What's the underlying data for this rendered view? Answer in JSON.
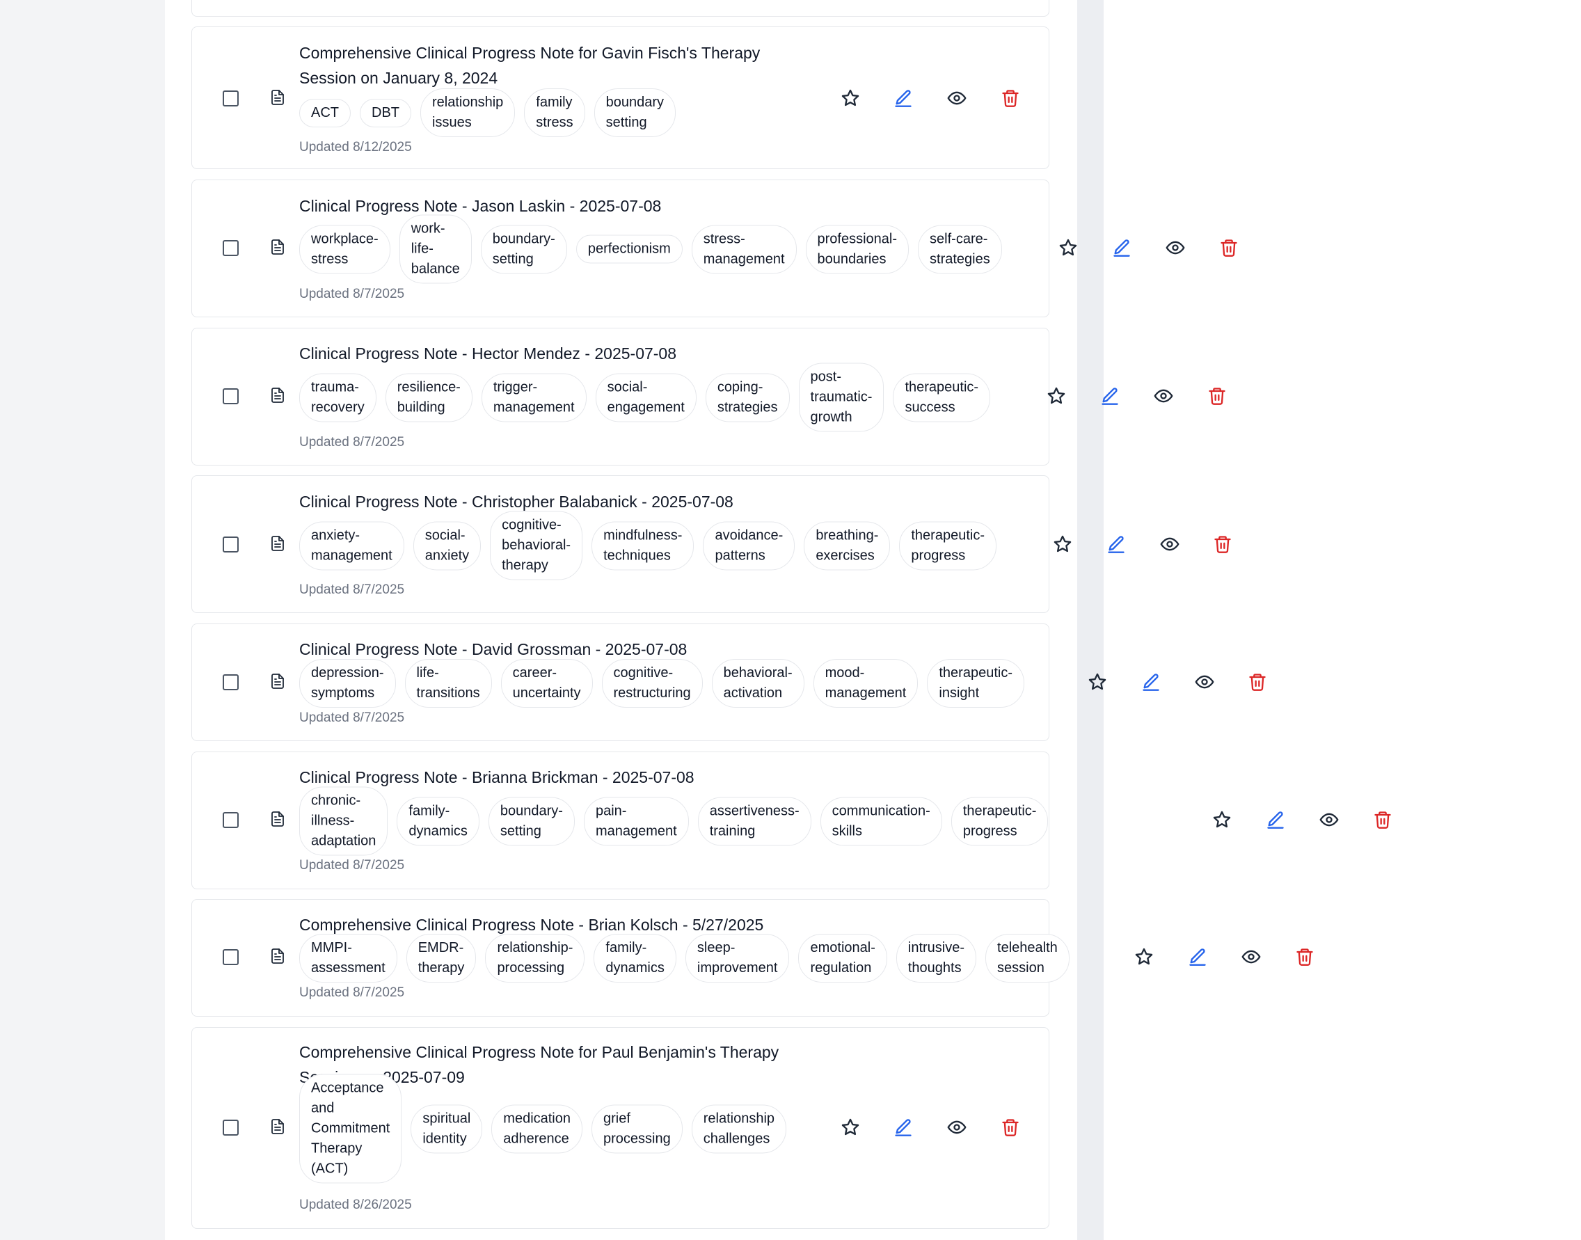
{
  "notes": [
    {
      "title": "Comprehensive Clinical Progress Note for Gavin Fisch's Therapy\nSession on January 8, 2024",
      "tags": [
        "ACT",
        "DBT",
        "relationship\nissues",
        "family\nstress",
        "boundary\nsetting"
      ],
      "updated": "Updated 8/12/2025"
    },
    {
      "title": "Clinical Progress Note - Jason Laskin - 2025-07-08",
      "tags": [
        "workplace-\nstress",
        "work-\nlife-\nbalance",
        "boundary-\nsetting",
        "perfectionism",
        "stress-\nmanagement",
        "professional-\nboundaries",
        "self-care-\nstrategies"
      ],
      "updated": "Updated 8/7/2025"
    },
    {
      "title": "Clinical Progress Note - Hector Mendez - 2025-07-08",
      "tags": [
        "trauma-\nrecovery",
        "resilience-\nbuilding",
        "trigger-\nmanagement",
        "social-\nengagement",
        "coping-\nstrategies",
        "post-\ntraumatic-\ngrowth",
        "therapeutic-\nsuccess"
      ],
      "updated": "Updated 8/7/2025"
    },
    {
      "title": "Clinical Progress Note - Christopher Balabanick - 2025-07-08",
      "tags": [
        "anxiety-\nmanagement",
        "social-\nanxiety",
        "cognitive-\nbehavioral-\ntherapy",
        "mindfulness-\ntechniques",
        "avoidance-\npatterns",
        "breathing-\nexercises",
        "therapeutic-\nprogress"
      ],
      "updated": "Updated 8/7/2025"
    },
    {
      "title": "Clinical Progress Note - David Grossman - 2025-07-08",
      "tags": [
        "depression-\nsymptoms",
        "life-\ntransitions",
        "career-\nuncertainty",
        "cognitive-\nrestructuring",
        "behavioral-\nactivation",
        "mood-\nmanagement",
        "therapeutic-\ninsight"
      ],
      "updated": "Updated 8/7/2025"
    },
    {
      "title": "Clinical Progress Note - Brianna Brickman - 2025-07-08",
      "tags": [
        "chronic-\nillness-\nadaptation",
        "family-\ndynamics",
        "boundary-\nsetting",
        "pain-\nmanagement",
        "assertiveness-\ntraining",
        "communication-\nskills",
        "therapeutic-\nprogress"
      ],
      "updated": "Updated 8/7/2025"
    },
    {
      "title": "Comprehensive Clinical Progress Note - Brian Kolsch - 5/27/2025",
      "tags": [
        "MMPI-\nassessment",
        "EMDR-\ntherapy",
        "relationship-\nprocessing",
        "family-\ndynamics",
        "sleep-\nimprovement",
        "emotional-\nregulation",
        "intrusive-\nthoughts",
        "telehealth\nsession"
      ],
      "updated": "Updated 8/7/2025"
    },
    {
      "title": "Comprehensive Clinical Progress Note for Paul Benjamin's Therapy\nSession on 2025-07-09",
      "tags": [
        "Acceptance\nand\nCommitment\nTherapy\n(ACT)",
        "spiritual\nidentity",
        "medication\nadherence",
        "grief\nprocessing",
        "relationship\nchallenges"
      ],
      "updated": "Updated 8/26/2025"
    }
  ],
  "icons": {
    "select": "checkbox",
    "document": "document-icon",
    "favorite": "star-icon",
    "edit": "pencil-icon",
    "view": "eye-icon",
    "delete": "trash-icon"
  },
  "colors": {
    "edit": "#2563eb",
    "delete": "#dc2626",
    "icon": "#1f2937",
    "muted": "#6b7280",
    "border": "#e5e7eb"
  }
}
